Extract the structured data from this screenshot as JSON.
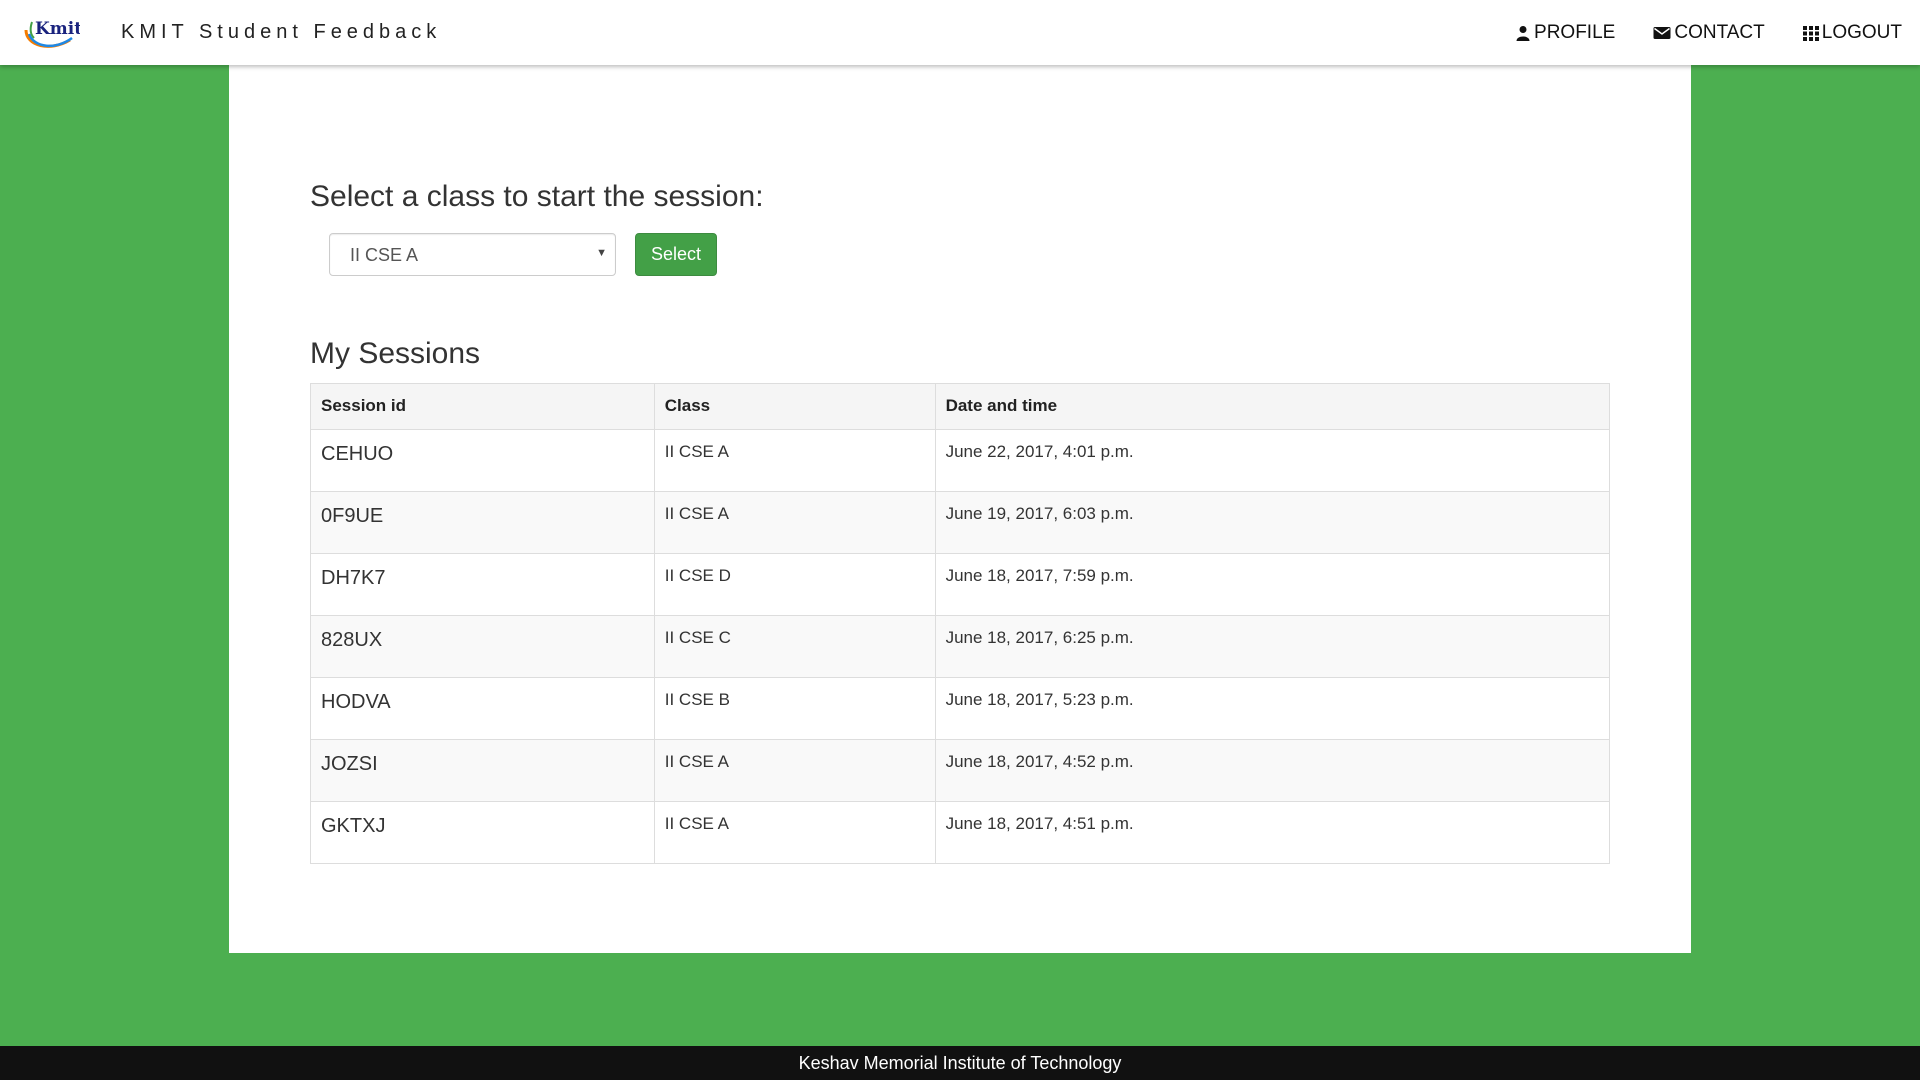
{
  "header": {
    "brand": "KMIT Student Feedback",
    "logo_text": "Kmit",
    "nav": [
      {
        "label": "PROFILE",
        "icon": "user-icon"
      },
      {
        "label": "CONTACT",
        "icon": "envelope-icon"
      },
      {
        "label": "LOGOUT",
        "icon": "grid-icon"
      }
    ]
  },
  "main": {
    "heading": "Select a class to start the session:",
    "class_select": {
      "selected": "II CSE A"
    },
    "select_button": "Select",
    "sessions_title": "My Sessions",
    "table": {
      "columns": [
        "Session id",
        "Class",
        "Date and time"
      ],
      "rows": [
        [
          "CEHUO",
          "II CSE A",
          "June 22, 2017, 4:01 p.m."
        ],
        [
          "0F9UE",
          "II CSE A",
          "June 19, 2017, 6:03 p.m."
        ],
        [
          "DH7K7",
          "II CSE D",
          "June 18, 2017, 7:59 p.m."
        ],
        [
          "828UX",
          "II CSE C",
          "June 18, 2017, 6:25 p.m."
        ],
        [
          "HODVA",
          "II CSE B",
          "June 18, 2017, 5:23 p.m."
        ],
        [
          "JOZSI",
          "II CSE A",
          "June 18, 2017, 4:52 p.m."
        ],
        [
          "GKTXJ",
          "II CSE A",
          "June 18, 2017, 4:51 p.m."
        ]
      ]
    }
  },
  "footer": {
    "text": "Keshav Memorial Institute of Technology"
  },
  "colors": {
    "background": "#4caf50",
    "button": "#43a047",
    "footer": "#111111"
  }
}
